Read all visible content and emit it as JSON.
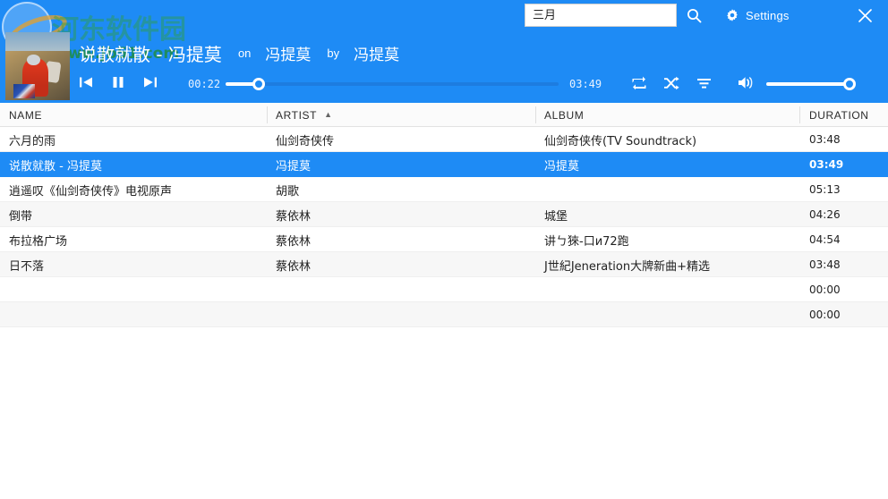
{
  "header": {
    "search": {
      "value": "三月",
      "placeholder": ""
    },
    "search_icon": "search-icon",
    "settings_label": "Settings",
    "settings_icon": "gear-icon",
    "close_icon": "close-icon",
    "accent_color": "#1e8bf5"
  },
  "watermark": {
    "text": "河东软件园",
    "url": "www.jb51.com",
    "logo": "circle-logo"
  },
  "player": {
    "track_name": "说散就散 - 冯提莫",
    "on_label": "on",
    "album": "冯提莫",
    "by_label": "by",
    "artist": "冯提莫",
    "time_current": "00:22",
    "time_total": "03:49",
    "progress_percent": 10,
    "volume_percent": 100,
    "controls": {
      "previous": "previous-icon",
      "pause": "pause-icon",
      "next": "next-icon",
      "repeat": "repeat-icon",
      "shuffle": "shuffle-icon",
      "playlist": "playlist-icon",
      "volume": "volume-icon"
    }
  },
  "table": {
    "columns": [
      {
        "label": "NAME",
        "sorted": false
      },
      {
        "label": "ARTIST",
        "sorted": true,
        "sort_arrow": "▲"
      },
      {
        "label": "ALBUM",
        "sorted": false
      },
      {
        "label": "DURATION",
        "sorted": false
      }
    ],
    "rows": [
      {
        "name": "六月的雨",
        "artist": "仙剑奇侠传",
        "album": "仙剑奇侠传(TV Soundtrack)",
        "duration": "03:48",
        "selected": false
      },
      {
        "name": "说散就散 - 冯提莫",
        "artist": "冯提莫",
        "album": "冯提莫",
        "duration": "03:49",
        "selected": true
      },
      {
        "name": "逍遥叹《仙剑奇侠传》电视原声",
        "artist": "胡歌",
        "album": "",
        "duration": "05:13",
        "selected": false
      },
      {
        "name": "倒带",
        "artist": "蔡依林",
        "album": "城堡",
        "duration": "04:26",
        "selected": false
      },
      {
        "name": "布拉格广场",
        "artist": "蔡依林",
        "album": "讲ㄅ猍-口и72跑",
        "duration": "04:54",
        "selected": false
      },
      {
        "name": "日不落",
        "artist": "蔡依林",
        "album": "J世紀Jeneration大牌新曲+精选",
        "duration": "03:48",
        "selected": false
      },
      {
        "name": "",
        "artist": "",
        "album": "",
        "duration": "00:00",
        "selected": false
      },
      {
        "name": "",
        "artist": "",
        "album": "",
        "duration": "00:00",
        "selected": false
      }
    ]
  }
}
